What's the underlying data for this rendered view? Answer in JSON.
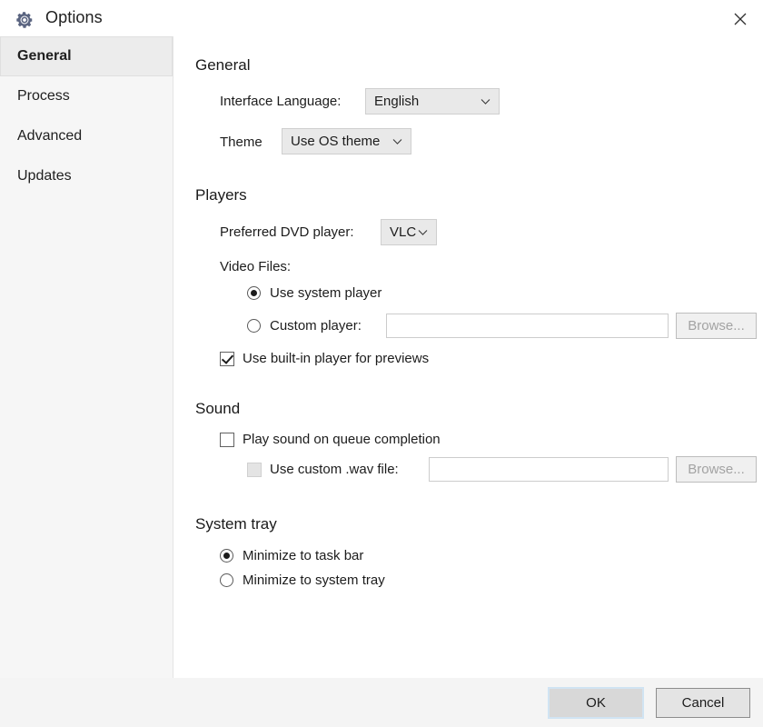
{
  "window": {
    "title": "Options",
    "gear_icon": "gear-icon",
    "close_icon": "close-icon"
  },
  "sidebar": {
    "items": [
      {
        "label": "General",
        "selected": true
      },
      {
        "label": "Process",
        "selected": false
      },
      {
        "label": "Advanced",
        "selected": false
      },
      {
        "label": "Updates",
        "selected": false
      }
    ]
  },
  "general": {
    "heading": "General",
    "interface_language_label": "Interface Language:",
    "interface_language_value": "English",
    "theme_label": "Theme",
    "theme_value": "Use OS theme"
  },
  "players": {
    "heading": "Players",
    "preferred_dvd_label": "Preferred DVD player:",
    "preferred_dvd_value": "VLC",
    "video_files_label": "Video Files:",
    "use_system_player_label": "Use system player",
    "use_system_player_selected": true,
    "custom_player_label": "Custom player:",
    "custom_player_selected": false,
    "custom_player_value": "",
    "custom_player_placeholder": "",
    "browse_label": "Browse...",
    "builtin_preview_label": "Use built-in player for previews",
    "builtin_preview_checked": true
  },
  "sound": {
    "heading": "Sound",
    "play_sound_label": "Play sound on queue completion",
    "play_sound_checked": false,
    "custom_wav_label": "Use custom .wav file:",
    "custom_wav_checked": false,
    "custom_wav_value": "",
    "custom_wav_placeholder": "",
    "browse_label": "Browse..."
  },
  "system_tray": {
    "heading": "System tray",
    "minimize_taskbar_label": "Minimize to task bar",
    "minimize_taskbar_selected": true,
    "minimize_tray_label": "Minimize to system tray",
    "minimize_tray_selected": false
  },
  "footer": {
    "ok_label": "OK",
    "cancel_label": "Cancel"
  },
  "colors": {
    "gear": "#5a6480",
    "sidebar_bg": "#f6f6f6",
    "selected_item_bg": "#ececec",
    "footer_bg": "#f4f4f4",
    "focus_ring": "#cfe3f3"
  }
}
